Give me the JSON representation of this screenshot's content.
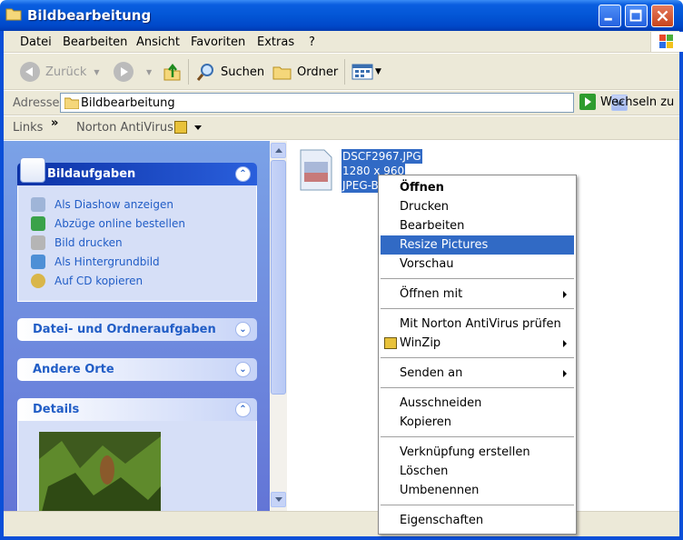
{
  "window": {
    "title": "Bildbearbeitung"
  },
  "menu": [
    "Datei",
    "Bearbeiten",
    "Ansicht",
    "Favoriten",
    "Extras",
    "?"
  ],
  "toolbar": {
    "back": "Zurück",
    "search": "Suchen",
    "folders": "Ordner"
  },
  "address": {
    "label": "Adresse",
    "value": "Bildbearbeitung",
    "go": "Wechseln zu"
  },
  "links": {
    "label": "Links",
    "chevron": "»",
    "norton": "Norton AntiVirus"
  },
  "tasks": {
    "picture_title": "Bildaufgaben",
    "picture_items": [
      "Als Diashow anzeigen",
      "Abzüge online bestellen",
      "Bild drucken",
      "Als Hintergrundbild",
      "Auf CD kopieren"
    ],
    "file_title": "Datei- und Ordneraufgaben",
    "other_title": "Andere Orte",
    "details_title": "Details"
  },
  "file": {
    "name": "DSCF2967.JPG",
    "dims": "1280 x 960",
    "type": "JPEG-B"
  },
  "context_menu": {
    "open": "Öffnen",
    "print": "Drucken",
    "edit": "Bearbeiten",
    "resize": "Resize Pictures",
    "preview": "Vorschau",
    "open_with": "Öffnen mit",
    "norton": "Mit Norton AntiVirus prüfen",
    "winzip": "WinZip",
    "send_to": "Senden an",
    "cut": "Ausschneiden",
    "copy": "Kopieren",
    "shortcut": "Verknüpfung erstellen",
    "delete": "Löschen",
    "rename": "Umbenennen",
    "properties": "Eigenschaften"
  },
  "colors": {
    "title_blue": "#0356d6",
    "selection": "#316ac5",
    "task_link": "#215dc6",
    "close_red": "#c8441c"
  }
}
